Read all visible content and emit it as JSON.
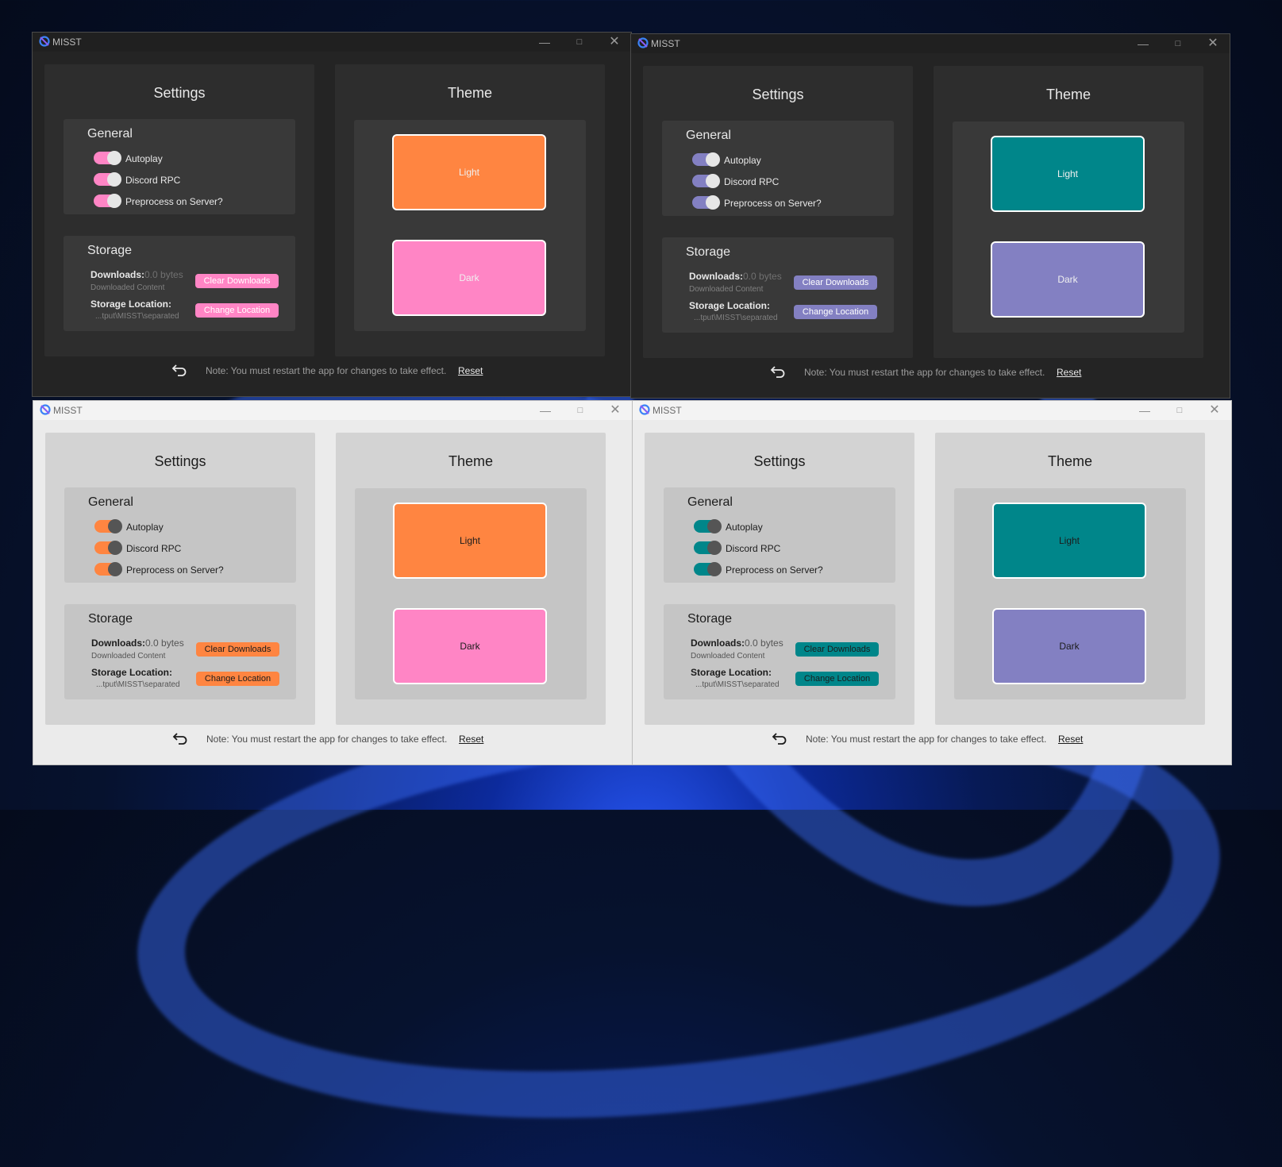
{
  "windows": [
    {
      "mode": "dark",
      "title": "MISST",
      "accent_light": "#ff8541",
      "accent_dark": "#ff85c5",
      "toggle_color": "#ff85c5",
      "button_color": "#ff85c5",
      "button_text_color": "#ffffff",
      "settings_title": "Settings",
      "general_title": "General",
      "options": [
        {
          "label": "Autoplay",
          "on": true
        },
        {
          "label": "Discord RPC",
          "on": true
        },
        {
          "label": "Preprocess on Server?",
          "on": true
        }
      ],
      "storage_title": "Storage",
      "downloads_label": "Downloads:",
      "downloads_value": "0.0 bytes",
      "downloads_sub": "Downloaded Content",
      "clear_label": "Clear Downloads",
      "location_label": "Storage Location:",
      "location_value": "...tput\\MISST\\separated",
      "change_label": "Change Location",
      "theme_title": "Theme",
      "light_label": "Light",
      "dark_label": "Dark",
      "note": "Note: You must restart the app for changes to take effect.",
      "reset_label": "Reset"
    },
    {
      "mode": "dark",
      "title": "MISST",
      "accent_light": "#00868a",
      "accent_dark": "#8380c2",
      "toggle_color": "#8380c2",
      "button_color": "#8380c2",
      "button_text_color": "#ffffff",
      "settings_title": "Settings",
      "general_title": "General",
      "options": [
        {
          "label": "Autoplay",
          "on": true
        },
        {
          "label": "Discord RPC",
          "on": true
        },
        {
          "label": "Preprocess on Server?",
          "on": true
        }
      ],
      "storage_title": "Storage",
      "downloads_label": "Downloads:",
      "downloads_value": "0.0 bytes",
      "downloads_sub": "Downloaded Content",
      "clear_label": "Clear Downloads",
      "location_label": "Storage Location:",
      "location_value": "...tput\\MISST\\separated",
      "change_label": "Change Location",
      "theme_title": "Theme",
      "light_label": "Light",
      "dark_label": "Dark",
      "note": "Note: You must restart the app for changes to take effect.",
      "reset_label": "Reset"
    },
    {
      "mode": "light",
      "title": "MISST",
      "accent_light": "#ff8541",
      "accent_dark": "#ff85c5",
      "toggle_color": "#ff8541",
      "button_color": "#ff8541",
      "button_text_color": "#1c1c1c",
      "settings_title": "Settings",
      "general_title": "General",
      "options": [
        {
          "label": "Autoplay",
          "on": true
        },
        {
          "label": "Discord RPC",
          "on": true
        },
        {
          "label": "Preprocess on Server?",
          "on": true
        }
      ],
      "storage_title": "Storage",
      "downloads_label": "Downloads:",
      "downloads_value": "0.0 bytes",
      "downloads_sub": "Downloaded Content",
      "clear_label": "Clear Downloads",
      "location_label": "Storage Location:",
      "location_value": "...tput\\MISST\\separated",
      "change_label": "Change Location",
      "theme_title": "Theme",
      "light_label": "Light",
      "dark_label": "Dark",
      "note": "Note: You must restart the app for changes to take effect.",
      "reset_label": "Reset"
    },
    {
      "mode": "light",
      "title": "MISST",
      "accent_light": "#00868a",
      "accent_dark": "#8380c2",
      "toggle_color": "#00868a",
      "button_color": "#00868a",
      "button_text_color": "#1c1c1c",
      "settings_title": "Settings",
      "general_title": "General",
      "options": [
        {
          "label": "Autoplay",
          "on": true
        },
        {
          "label": "Discord RPC",
          "on": true
        },
        {
          "label": "Preprocess on Server?",
          "on": true
        }
      ],
      "storage_title": "Storage",
      "downloads_label": "Downloads:",
      "downloads_value": "0.0 bytes",
      "downloads_sub": "Downloaded Content",
      "clear_label": "Clear Downloads",
      "location_label": "Storage Location:",
      "location_value": "...tput\\MISST\\separated",
      "change_label": "Change Location",
      "theme_title": "Theme",
      "light_label": "Light",
      "dark_label": "Dark",
      "note": "Note: You must restart the app for changes to take effect.",
      "reset_label": "Reset"
    }
  ]
}
